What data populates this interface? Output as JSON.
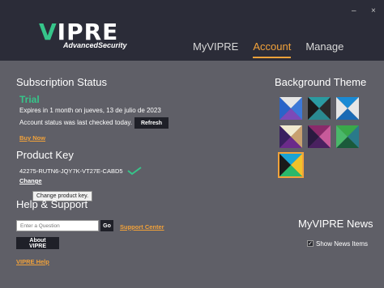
{
  "header": {
    "logo_text": "VIPRE",
    "logo_subtitle": "AdvancedSecurity",
    "minimize": "–",
    "close": "×",
    "tabs": [
      {
        "label": "MyVIPRE"
      },
      {
        "label": "Account"
      },
      {
        "label": "Manage"
      }
    ],
    "active_tab": "Account"
  },
  "subscription": {
    "title": "Subscription Status",
    "status": "Trial",
    "expires": "Expires in 1 month on jueves, 13 de julio de 2023",
    "last_checked": "Account status was last checked today.",
    "refresh_label": "Refresh",
    "buy_now": "Buy Now"
  },
  "product_key": {
    "title": "Product Key",
    "key": "42275-RUTN6-JQY7K-VT27E-CABD5",
    "change": "Change",
    "tooltip": "Change product key."
  },
  "help": {
    "title": "Help & Support",
    "search_placeholder": "Enter a Question",
    "go_label": "Go",
    "support_center": "Support Center",
    "about": "About VIPRE",
    "vipre_help": "VIPRE Help"
  },
  "background_theme": {
    "title": "Background Theme",
    "swatches": [
      {
        "name": "theme-blue-purple",
        "colors": [
          "#e6e6e6",
          "#3c78d8",
          "#7c4ab8",
          "#2a64c8"
        ]
      },
      {
        "name": "theme-teal",
        "colors": [
          "#2a9aa0",
          "#2a2a2a",
          "#2a8a90",
          "#1a1a1a"
        ]
      },
      {
        "name": "theme-blue",
        "colors": [
          "#1a8ad4",
          "#e6e6e6",
          "#1a6ab4",
          "#e6e6e6"
        ]
      },
      {
        "name": "theme-warm",
        "colors": [
          "#f0ead0",
          "#c8a070",
          "#6b2a8a",
          "#3a2060"
        ]
      },
      {
        "name": "theme-pink",
        "colors": [
          "#8a2a6a",
          "#c85a9a",
          "#4a2060",
          "#2a1a40"
        ]
      },
      {
        "name": "theme-green",
        "colors": [
          "#3aa84a",
          "#2a7a8a",
          "#1a5a3a",
          "#4ab86a"
        ]
      },
      {
        "name": "theme-colorful",
        "colors": [
          "#1aa4d4",
          "#f2c22a",
          "#2ab86a",
          "#1a1a1a"
        ]
      }
    ],
    "selected_index": 6
  },
  "myvipre_news": {
    "title": "MyVIPRE News",
    "show_label": "Show News Items",
    "checked": true
  },
  "colors": {
    "accent": "#f2a23a",
    "brand_green": "#36c58a",
    "header_bg": "#2b2c38",
    "body_bg": "#5f5f67"
  }
}
